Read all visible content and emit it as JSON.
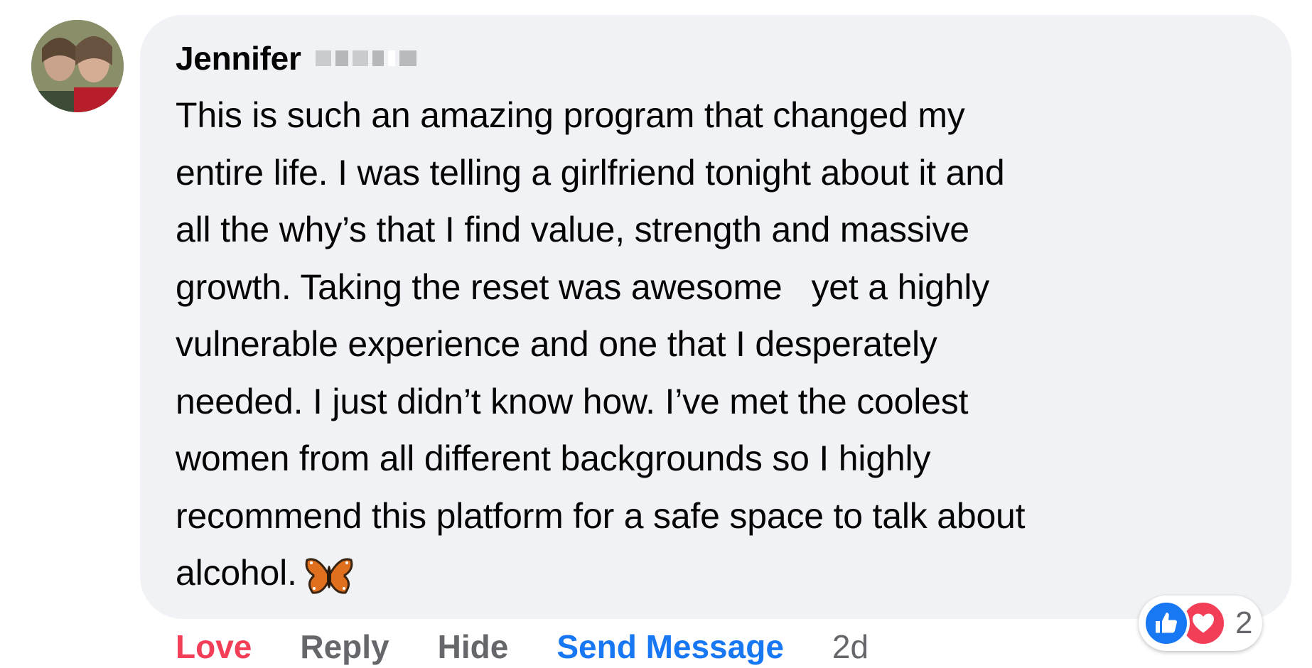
{
  "comment": {
    "author": "Jennifer",
    "text": "This is such an amazing program that changed my\nentire life. I was telling a girlfriend tonight about it and\nall the why’s that I find value, strength and massive\ngrowth. Taking the reset was awesome   yet a highly\nvulnerable experience and one that I desperately\nneeded. I just didn’t know how. I’ve met the coolest\nwomen from all different backgrounds so I highly\nrecommend this platform for a safe space to talk about\nalcohol.",
    "emoji": "butterfly-icon"
  },
  "actions": {
    "love": "Love",
    "reply": "Reply",
    "hide": "Hide",
    "send_message": "Send Message",
    "timestamp": "2d"
  },
  "reactions": {
    "count": "2",
    "types": [
      "like-icon",
      "love-icon"
    ]
  },
  "colors": {
    "bubble": "#f0f2f5",
    "love": "#f33e58",
    "link": "#1877f2",
    "muted": "#65676b",
    "text": "#050505"
  }
}
